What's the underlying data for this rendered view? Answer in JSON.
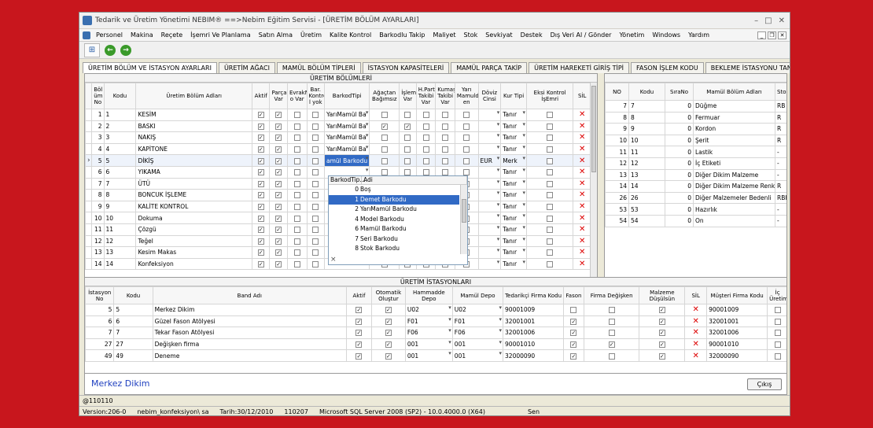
{
  "window": {
    "title": "Tedarik ve Üretim Yönetimi   NEBIM® ==>Nebim Eğitim Servisi - [ÜRETİM BÖLÜM AYARLARI]"
  },
  "menu": [
    "Personel",
    "Makina",
    "Reçete",
    "İşemri Ve Planlama",
    "Satın Alma",
    "Üretim",
    "Kalite Kontrol",
    "Barkodlu Takip",
    "Maliyet",
    "Stok",
    "Sevkiyat",
    "Destek",
    "Dış Veri Al / Gönder",
    "Yönetim",
    "Windows",
    "Yardım"
  ],
  "tabs": [
    "ÜRETİM BÖLÜM VE İSTASYON AYARLARI",
    "ÜRETİM AĞACI",
    "MAMÜL BÖLÜM TİPLERİ",
    "İSTASYON KAPASİTELERİ",
    "MAMÜL PARÇA TAKİP",
    "ÜRETİM HAREKETİ GİRİŞ TİPİ",
    "FASON İŞLEM KODU",
    "BEKLEME İSTASYONU TANIM"
  ],
  "bolumler": {
    "title": "ÜRETİM BÖLÜMLERİ",
    "headers": [
      "Böl üm No",
      "Kodu",
      "Üretim Bölüm Adları",
      "Aktif",
      "Parça Var",
      "EvrakN o Var",
      "Bar. Kontro l yok",
      "BarkodTipi",
      "Ağaçtan Bağımsız",
      "İşlem Var",
      "H.Parti Takibi Var",
      "Kumaş Takibi Var",
      "Yarı Mamuld en",
      "Döviz Cinsi",
      "Kur Tipi",
      "Eksi Kontrol İşEmri",
      "SİL"
    ],
    "rows": [
      {
        "no": "1",
        "kodu": "1",
        "ad": "KESİM",
        "aktif": true,
        "parca": true,
        "evrak": false,
        "bar": false,
        "barkod": "YarıMamül Ba",
        "agac": false,
        "islem": false,
        "hparti": false,
        "kumas": false,
        "yari": false,
        "doviz": "",
        "kur": "Tanır"
      },
      {
        "no": "2",
        "kodu": "2",
        "ad": "BASKI",
        "aktif": true,
        "parca": true,
        "evrak": false,
        "bar": false,
        "barkod": "YarıMamül Ba",
        "agac": true,
        "islem": true,
        "hparti": false,
        "kumas": false,
        "yari": false,
        "doviz": "",
        "kur": "Tanır"
      },
      {
        "no": "3",
        "kodu": "3",
        "ad": "NAKIŞ",
        "aktif": true,
        "parca": true,
        "evrak": false,
        "bar": false,
        "barkod": "YarıMamül Ba",
        "agac": false,
        "islem": false,
        "hparti": false,
        "kumas": false,
        "yari": false,
        "doviz": "",
        "kur": "Tanır"
      },
      {
        "no": "4",
        "kodu": "4",
        "ad": "KAPİTONE",
        "aktif": true,
        "parca": true,
        "evrak": false,
        "bar": false,
        "barkod": "YarıMamül Ba",
        "agac": false,
        "islem": false,
        "hparti": false,
        "kumas": false,
        "yari": false,
        "doviz": "",
        "kur": "Tanır"
      },
      {
        "no": "5",
        "kodu": "5",
        "ad": "DİKİŞ",
        "aktif": true,
        "parca": true,
        "evrak": false,
        "bar": false,
        "barkod": "amül Barkodu",
        "agac": false,
        "islem": false,
        "hparti": false,
        "kumas": false,
        "yari": false,
        "doviz": "EUR",
        "kur": "Merk"
      },
      {
        "no": "6",
        "kodu": "6",
        "ad": "YIKAMA",
        "aktif": true,
        "parca": true,
        "evrak": false,
        "bar": false,
        "barkod": "",
        "agac": false,
        "islem": false,
        "hparti": false,
        "kumas": false,
        "yari": false,
        "doviz": "",
        "kur": "Tanır"
      },
      {
        "no": "7",
        "kodu": "7",
        "ad": "ÜTÜ",
        "aktif": true,
        "parca": true,
        "evrak": false,
        "bar": false,
        "barkod": "",
        "agac": false,
        "islem": false,
        "hparti": false,
        "kumas": false,
        "yari": false,
        "doviz": "",
        "kur": "Tanır"
      },
      {
        "no": "8",
        "kodu": "8",
        "ad": "BONCUK İŞLEME",
        "aktif": true,
        "parca": true,
        "evrak": false,
        "bar": false,
        "barkod": "",
        "agac": false,
        "islem": false,
        "hparti": false,
        "kumas": false,
        "yari": false,
        "doviz": "",
        "kur": "Tanır"
      },
      {
        "no": "9",
        "kodu": "9",
        "ad": "KALİTE KONTROL",
        "aktif": true,
        "parca": true,
        "evrak": false,
        "bar": false,
        "barkod": "",
        "agac": false,
        "islem": false,
        "hparti": false,
        "kumas": false,
        "yari": false,
        "doviz": "",
        "kur": "Tanır"
      },
      {
        "no": "10",
        "kodu": "10",
        "ad": "Dokuma",
        "aktif": true,
        "parca": true,
        "evrak": false,
        "bar": false,
        "barkod": "",
        "agac": false,
        "islem": false,
        "hparti": false,
        "kumas": false,
        "yari": false,
        "doviz": "",
        "kur": "Tanır"
      },
      {
        "no": "11",
        "kodu": "11",
        "ad": "Çözgü",
        "aktif": true,
        "parca": true,
        "evrak": false,
        "bar": false,
        "barkod": "",
        "agac": false,
        "islem": false,
        "hparti": false,
        "kumas": false,
        "yari": false,
        "doviz": "",
        "kur": "Tanır"
      },
      {
        "no": "12",
        "kodu": "12",
        "ad": "Teğel",
        "aktif": true,
        "parca": true,
        "evrak": false,
        "bar": false,
        "barkod": "",
        "agac": false,
        "islem": false,
        "hparti": false,
        "kumas": false,
        "yari": false,
        "doviz": "",
        "kur": "Tanır"
      },
      {
        "no": "13",
        "kodu": "13",
        "ad": "Kesim Makas",
        "aktif": true,
        "parca": true,
        "evrak": false,
        "bar": false,
        "barkod": "",
        "agac": false,
        "islem": false,
        "hparti": false,
        "kumas": false,
        "yari": false,
        "doviz": "",
        "kur": "Tanır"
      },
      {
        "no": "14",
        "kodu": "14",
        "ad": "Konfeksiyon",
        "aktif": true,
        "parca": true,
        "evrak": false,
        "bar": false,
        "barkod": "",
        "agac": false,
        "islem": false,
        "hparti": false,
        "kumas": false,
        "yari": false,
        "doviz": "",
        "kur": "Tanır"
      }
    ]
  },
  "barkodPopup": {
    "headers": [
      "BarkodTip...",
      "Adi"
    ],
    "items": [
      {
        "n": "0",
        "ad": "Boş"
      },
      {
        "n": "1",
        "ad": "Demet Barkodu",
        "selected": true
      },
      {
        "n": "2",
        "ad": "YarıMamül Barkodu"
      },
      {
        "n": "4",
        "ad": "Model Barkodu"
      },
      {
        "n": "6",
        "ad": "Mamül Barkodu"
      },
      {
        "n": "7",
        "ad": "Seri Barkodu"
      },
      {
        "n": "8",
        "ad": "Stok Barkodu"
      }
    ],
    "close": "×"
  },
  "malzeme": {
    "headers": [
      "NO",
      "Kodu",
      "SıraNo",
      "Mamül Bölüm Adları",
      "Stok"
    ],
    "rows": [
      {
        "no": "7",
        "kodu": "7",
        "sira": "0",
        "ad": "Düğme",
        "stok": "RB"
      },
      {
        "no": "8",
        "kodu": "8",
        "sira": "0",
        "ad": "Fermuar",
        "stok": "R"
      },
      {
        "no": "9",
        "kodu": "9",
        "sira": "0",
        "ad": "Kordon",
        "stok": "R"
      },
      {
        "no": "10",
        "kodu": "10",
        "sira": "0",
        "ad": "Şerit",
        "stok": "R"
      },
      {
        "no": "11",
        "kodu": "11",
        "sira": "0",
        "ad": "Lastik",
        "stok": "-"
      },
      {
        "no": "12",
        "kodu": "12",
        "sira": "0",
        "ad": "İç Etiketi",
        "stok": "-"
      },
      {
        "no": "13",
        "kodu": "13",
        "sira": "0",
        "ad": "Diğer Dikim Malzeme",
        "stok": "-"
      },
      {
        "no": "14",
        "kodu": "14",
        "sira": "0",
        "ad": "Diğer Dikim Malzeme Renkli",
        "stok": "R"
      },
      {
        "no": "26",
        "kodu": "26",
        "sira": "0",
        "ad": "Diğer Malzemeler Bedenli",
        "stok": "RBK"
      },
      {
        "no": "53",
        "kodu": "53",
        "sira": "0",
        "ad": "Hazırlık",
        "stok": "-"
      },
      {
        "no": "54",
        "kodu": "54",
        "sira": "0",
        "ad": "On",
        "stok": "-"
      }
    ]
  },
  "istasyonlar": {
    "title": "ÜRETİM İSTASYONLARI",
    "headers": [
      "İstasyon No",
      "Kodu",
      "Band Adı",
      "Aktif",
      "Otomatik Oluştur",
      "Hammadde Depo",
      "Mamül Depo",
      "Tedarikçi Firma Kodu",
      "Fason",
      "Firma Değişken",
      "Malzeme Düşülsün",
      "SİL",
      "Müşteri Firma Kodu",
      "İç Üretim"
    ],
    "rows": [
      {
        "no": "5",
        "kodu": "5",
        "ad": "Merkez Dikim",
        "aktif": true,
        "oto": true,
        "ham": "U02",
        "mam": "U02",
        "ted": "90001009",
        "fason": false,
        "degisken": false,
        "malz": true,
        "mus": "90001009",
        "ic": false
      },
      {
        "no": "6",
        "kodu": "6",
        "ad": "Güzel Fason Atölyesi",
        "aktif": true,
        "oto": true,
        "ham": "F01",
        "mam": "F01",
        "ted": "32001001",
        "fason": true,
        "degisken": false,
        "malz": true,
        "mus": "32001001",
        "ic": false
      },
      {
        "no": "7",
        "kodu": "7",
        "ad": "Tekar Fason Atölyesi",
        "aktif": true,
        "oto": true,
        "ham": "F06",
        "mam": "F06",
        "ted": "32001006",
        "fason": true,
        "degisken": false,
        "malz": true,
        "mus": "32001006",
        "ic": false
      },
      {
        "no": "27",
        "kodu": "27",
        "ad": "Değişken firma",
        "aktif": true,
        "oto": true,
        "ham": "001",
        "mam": "001",
        "ted": "90001010",
        "fason": true,
        "degisken": true,
        "malz": true,
        "mus": "90001010",
        "ic": false
      },
      {
        "no": "49",
        "kodu": "49",
        "ad": "Deneme",
        "aktif": true,
        "oto": true,
        "ham": "001",
        "mam": "001",
        "ted": "32000090",
        "fason": true,
        "degisken": false,
        "malz": true,
        "mus": "32000090",
        "ic": false
      }
    ]
  },
  "selectedName": "Merkez Dikim",
  "exitButton": "Çıkış",
  "statusbar": {
    "code": "@110110",
    "version": "Version:206-0",
    "user": "nebim_konfeksiyon\\ sa",
    "date": "Tarih:30/12/2010",
    "num": "110207",
    "db": "Microsoft SQL Server 2008 (SP2) - 10.0.4000.0 (X64)",
    "end": "Sen"
  }
}
